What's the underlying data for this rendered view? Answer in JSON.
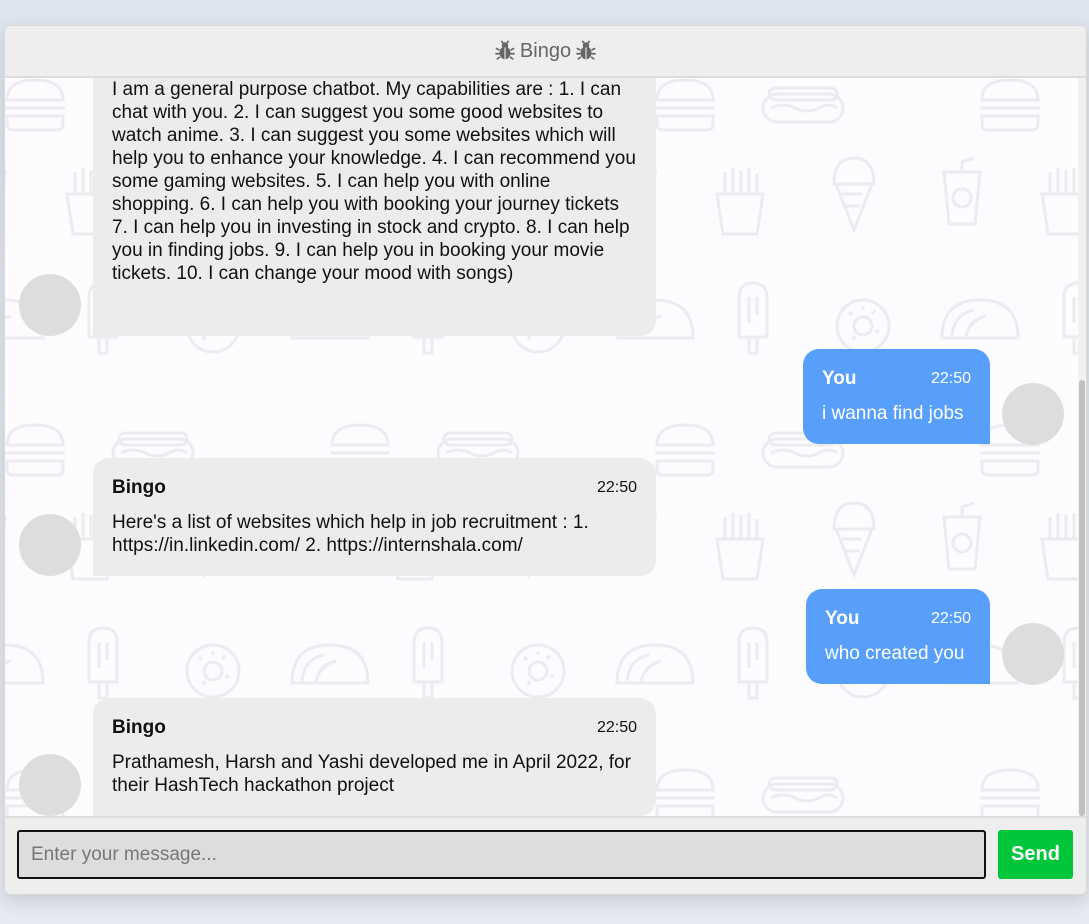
{
  "header": {
    "title": "Bingo",
    "icon": "bug-icon"
  },
  "messages": [
    {
      "side": "left",
      "text": "I am a general purpose chatbot. My capabilities are : 1. I can chat with you. 2. I can suggest you some good websites to watch anime. 3. I can suggest you some websites which will help you to enhance your knowledge. 4. I can recommend you some gaming websites. 5. I can help you with online shopping. 6. I can help you with booking your journey tickets 7. I can help you in investing in stock and crypto. 8. I can help you in finding jobs. 9. I can help you in booking your movie tickets. 10. I can change your mood with songs)"
    },
    {
      "side": "right",
      "name": "You",
      "time": "22:50",
      "text": "i wanna find jobs"
    },
    {
      "side": "left",
      "name": "Bingo",
      "time": "22:50",
      "text": "Here's a list of websites which help in job recruitment : 1. https://in.linkedin.com/ 2. https://internshala.com/"
    },
    {
      "side": "right",
      "name": "You",
      "time": "22:50",
      "text": "who created you"
    },
    {
      "side": "left",
      "name": "Bingo",
      "time": "22:50",
      "text": "Prathamesh, Harsh and Yashi developed me in April 2022, for their HashTech hackathon project"
    }
  ],
  "input": {
    "placeholder": "Enter your message...",
    "value": ""
  },
  "send_button": {
    "label": "Send"
  },
  "colors": {
    "user_bubble": "#579ffb",
    "bot_bubble": "#ececec",
    "send": "#00c73a"
  }
}
